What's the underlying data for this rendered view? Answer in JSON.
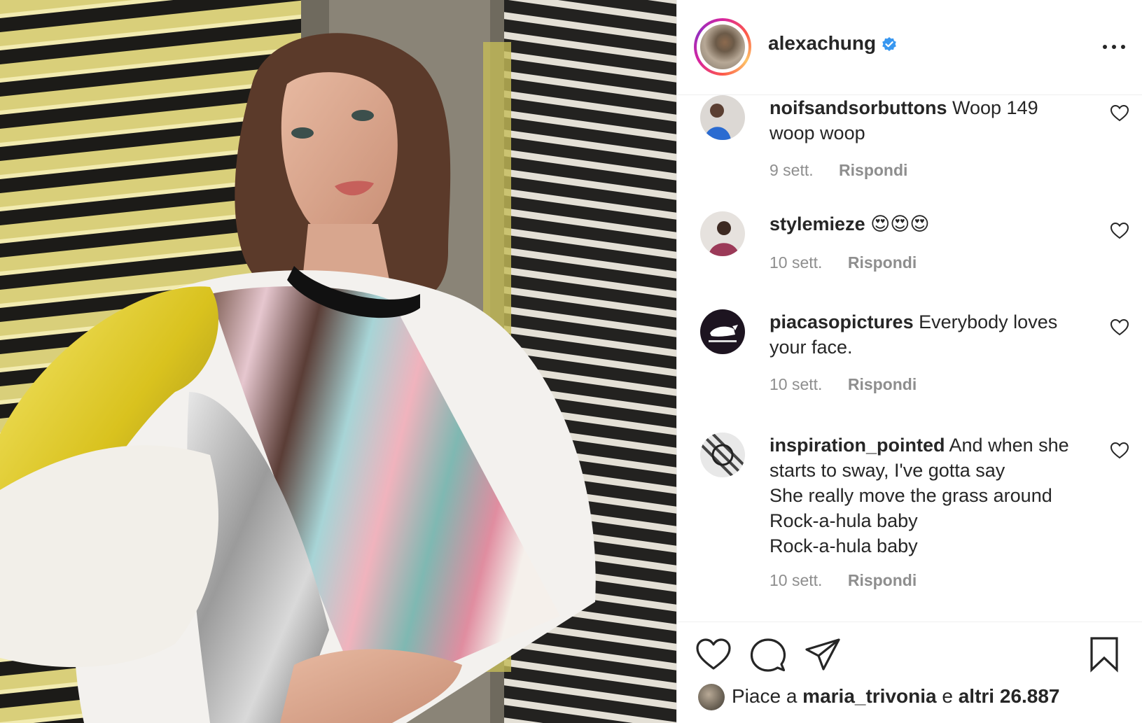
{
  "post": {
    "owner": "alexachung",
    "verified": true
  },
  "comments": [
    {
      "user": "noifsandsorbuttons",
      "text": "Woop 149\nwoop woop",
      "time": "9 sett.",
      "reply": "Rispondi"
    },
    {
      "user": "stylemieze",
      "text": "😍😍😍",
      "time": "10 sett.",
      "reply": "Rispondi"
    },
    {
      "user": "piacasopictures",
      "text": "Everybody loves\nyour face.",
      "time": "10 sett.",
      "reply": "Rispondi"
    },
    {
      "user": "inspiration_pointed",
      "text": "And when she\nstarts to sway, I've gotta say\nShe really move the grass around\nRock-a-hula baby\nRock-a-hula baby",
      "time": "10 sett.",
      "reply": "Rispondi"
    }
  ],
  "likes": {
    "prefix": "Piace a ",
    "user": "maria_trivonia",
    "joiner": " e ",
    "others": "altri 26.887"
  },
  "icons": {
    "like": "heart-icon",
    "comment": "comment-icon",
    "share": "send-icon",
    "save": "bookmark-icon",
    "more": "more-options-icon",
    "verified": "verified-badge-icon"
  },
  "colors": {
    "verified": "#3897f0",
    "secondary_text": "#8e8e8e",
    "primary_text": "#262626"
  }
}
